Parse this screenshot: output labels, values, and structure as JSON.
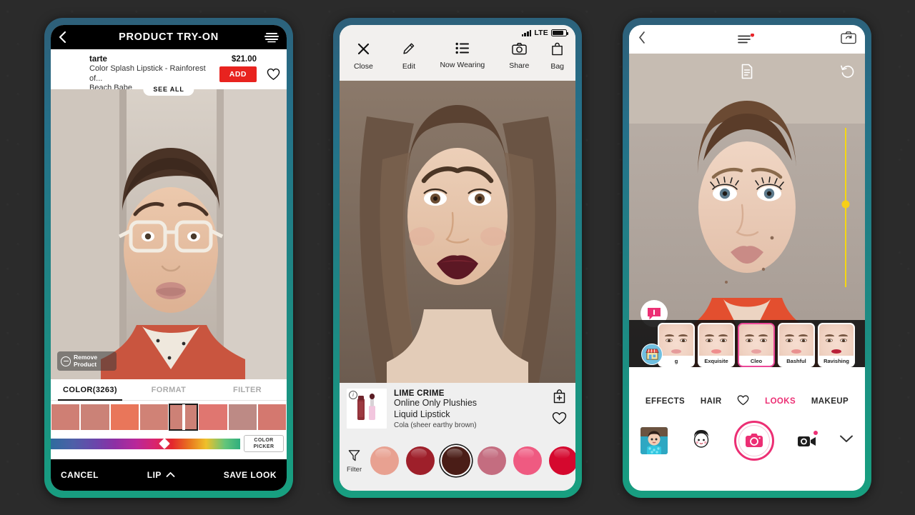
{
  "background_color": "#2b2b2b",
  "frame_gradient": {
    "top": "#2e5f79",
    "bottom": "#17a080"
  },
  "phone1": {
    "name": "product-try-on-app",
    "header": {
      "title": "PRODUCT TRY-ON",
      "back_icon": "chevron-left-icon",
      "menu_icon": "hamburger-icon"
    },
    "product": {
      "brand": "tarte",
      "name": "Color Splash Lipstick - Rainforest of...",
      "name_line2": "Beach Babe",
      "price": "$21.00",
      "add_label": "ADD",
      "add_color": "#e8231f",
      "favorite_icon": "heart-outline-icon",
      "see_all_label": "SEE ALL"
    },
    "camera": {
      "remove_label_line1": "Remove",
      "remove_label_line2": "Product",
      "remove_icon": "minus-circle-icon"
    },
    "tabs": [
      {
        "label": "COLOR(3263)",
        "active": true
      },
      {
        "label": "FORMAT",
        "active": false
      },
      {
        "label": "FILTER",
        "active": false
      }
    ],
    "swatches": [
      {
        "color": "#cf7f74",
        "selected": false
      },
      {
        "color": "#cb8277",
        "selected": false
      },
      {
        "color": "#e9765a",
        "selected": false
      },
      {
        "color": "#d08276",
        "selected": false
      },
      {
        "color": "#cd8176",
        "selected": true
      },
      {
        "color": "#e07670",
        "selected": false
      },
      {
        "color": "#bd8a85",
        "selected": false
      },
      {
        "color": "#d4786f",
        "selected": false
      }
    ],
    "color_picker_label_line1": "COLOR",
    "color_picker_label_line2": "PICKER",
    "slider_position_percent": 60,
    "bottom_bar": {
      "cancel_label": "CANCEL",
      "category_label": "LIP",
      "category_icon": "chevron-up-icon",
      "save_label": "SAVE LOOK"
    }
  },
  "phone2": {
    "name": "virtual-artist-app",
    "status_bar": {
      "carrier": "LTE",
      "signal_icon": "signal-bars-icon",
      "battery_icon": "battery-icon",
      "battery_percent": 82
    },
    "toolbar": [
      {
        "label": "Close",
        "icon": "close-x-icon"
      },
      {
        "label": "Edit",
        "icon": "pencil-icon"
      },
      {
        "label": "Now Wearing",
        "icon": "list-icon"
      },
      {
        "label": "Share",
        "icon": "camera-icon"
      },
      {
        "label": "Bag",
        "icon": "shopping-bag-icon"
      }
    ],
    "product_card": {
      "info_icon": "info-circle-icon",
      "thumbnail_icon": "lipstick-tube-icon",
      "brand": "LIME CRIME",
      "name_line1": "Online Only Plushies",
      "name_line2": "Liquid Lipstick",
      "shade": "Cola (sheer earthy brown)",
      "bag_icon": "bag-plus-icon",
      "favorite_icon": "heart-outline-icon"
    },
    "filter_label": "Filter",
    "filter_icon": "funnel-icon",
    "shades": [
      {
        "color": "#e8a191",
        "selected": false
      },
      {
        "color": "#9e1f2a",
        "selected": false
      },
      {
        "color": "#4a1d17",
        "selected": true
      },
      {
        "color": "#c46d80",
        "selected": false
      },
      {
        "color": "#ef5a81",
        "selected": false
      },
      {
        "color": "#d5082e",
        "selected": false
      }
    ]
  },
  "phone3": {
    "name": "makeup-camera-app",
    "header": {
      "back_icon": "chevron-left-icon",
      "menu_icon": "hamburger-badge-icon",
      "badge_color": "#e8252a",
      "flip_camera_icon": "camera-flip-icon"
    },
    "overlay": {
      "document_icon": "document-icon",
      "undo_icon": "undo-icon",
      "chat_icon": "chat-bubble-icon",
      "store_icon": "store-icon"
    },
    "slider": {
      "color": "#f5d712",
      "value_percent": 48
    },
    "looks": [
      {
        "label": "g",
        "selected": false,
        "lip": "#e59b9b"
      },
      {
        "label": "Exquisite",
        "selected": false,
        "lip": "#ef8d8d"
      },
      {
        "label": "Cleo",
        "selected": true,
        "lip": "#e8a0a0"
      },
      {
        "label": "Bashful",
        "selected": false,
        "lip": "#e9908f"
      },
      {
        "label": "Ravishing",
        "selected": false,
        "lip": "#b92038"
      }
    ],
    "tabs": [
      {
        "label": "EFFECTS",
        "active": false,
        "icon": ""
      },
      {
        "label": "HAIR",
        "active": false,
        "icon": ""
      },
      {
        "label": "",
        "active": false,
        "icon": "heart-outline-icon"
      },
      {
        "label": "LOOKS",
        "active": true,
        "icon": ""
      },
      {
        "label": "MAKEUP",
        "active": false,
        "icon": ""
      }
    ],
    "actions": {
      "gallery_icon": "gallery-thumbnail-icon",
      "avatar_icon": "face-avatar-icon",
      "shutter_icon": "camera-shutter-icon",
      "video_icon": "video-camera-icon",
      "collapse_icon": "chevron-down-icon",
      "accent_color": "#ec2f74"
    }
  }
}
